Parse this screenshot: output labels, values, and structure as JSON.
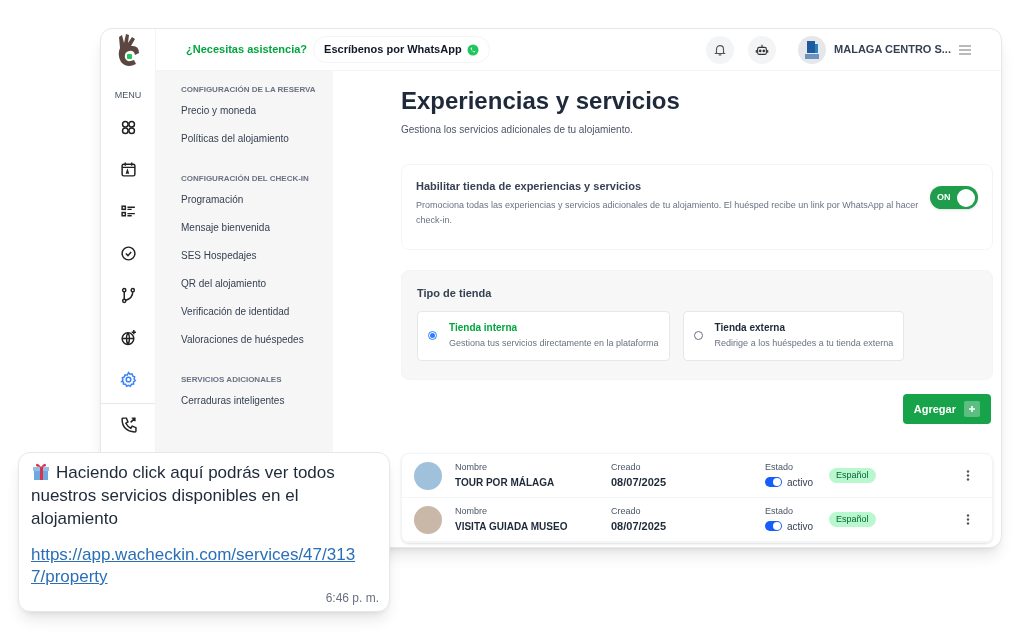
{
  "header": {
    "help_text": "¿Necesitas asistencia?",
    "whatsapp_button": "Escríbenos por WhatsApp",
    "account_name": "MALAGA CENTRO S..."
  },
  "rail": {
    "label": "MENU",
    "items": [
      {
        "kind": "grid",
        "selected": false
      },
      {
        "kind": "calendar",
        "selected": false
      },
      {
        "kind": "list",
        "selected": false
      },
      {
        "kind": "check",
        "selected": false
      },
      {
        "kind": "branch",
        "selected": false
      },
      {
        "kind": "globe",
        "selected": false
      },
      {
        "kind": "gear",
        "selected": true
      }
    ],
    "bottom_items": [
      {
        "kind": "phone",
        "selected": false
      }
    ]
  },
  "settings_menu": [
    {
      "heading": "CONFIGURACIÓN DE LA RESERVA",
      "items": [
        "Precio y moneda",
        "Políticas del alojamiento"
      ]
    },
    {
      "heading": "CONFIGURACIÓN DEL CHECK-IN",
      "items": [
        "Programación",
        "Mensaje bienvenida",
        "SES Hospedajes",
        "QR del alojamiento",
        "Verificación de identidad",
        "Valoraciones de huéspedes"
      ]
    },
    {
      "heading": "SERVICIOS ADICIONALES",
      "items": [
        "Cerraduras inteligentes"
      ]
    }
  ],
  "page": {
    "title": "Experiencias y servicios",
    "subtitle": "Gestiona los servicios adicionales de tu alojamiento."
  },
  "store_toggle": {
    "title": "Habilitar tienda de experiencias y servicios",
    "description": "Promociona todas las experiencias y servicios adicionales de tu alojamiento. El huésped recibe un link por WhatsApp al hacer check-in.",
    "on": true,
    "switch_label": "ON"
  },
  "store_type": {
    "title": "Tipo de tienda",
    "options": [
      {
        "title": "Tienda interna",
        "description": "Gestiona tus servicios directamente en la plataforma",
        "selected": true
      },
      {
        "title": "Tienda externa",
        "description": "Redirige a los huéspedes a tu tienda externa",
        "selected": false
      }
    ]
  },
  "add_button": "Agregar",
  "services": [
    {
      "name_label": "Nombre",
      "name": "TOUR POR MÁLAGA",
      "created_label": "Creado",
      "created": "08/07/2025",
      "status_label": "Estado",
      "active": true,
      "status": "activo",
      "language": "Español"
    },
    {
      "name_label": "Nombre",
      "name": "VISITA GUIADA MUSEO",
      "created_label": "Creado",
      "created": "08/07/2025",
      "status_label": "Estado",
      "active": true,
      "status": "activo",
      "language": "Español"
    }
  ],
  "chat_message": {
    "text": "Haciendo click aquí podrás ver todos nuestros servicios disponibles en el alojamiento",
    "link": "https://app.wacheckin.com/services/47/3137/property",
    "time": "6:46 p. m."
  }
}
